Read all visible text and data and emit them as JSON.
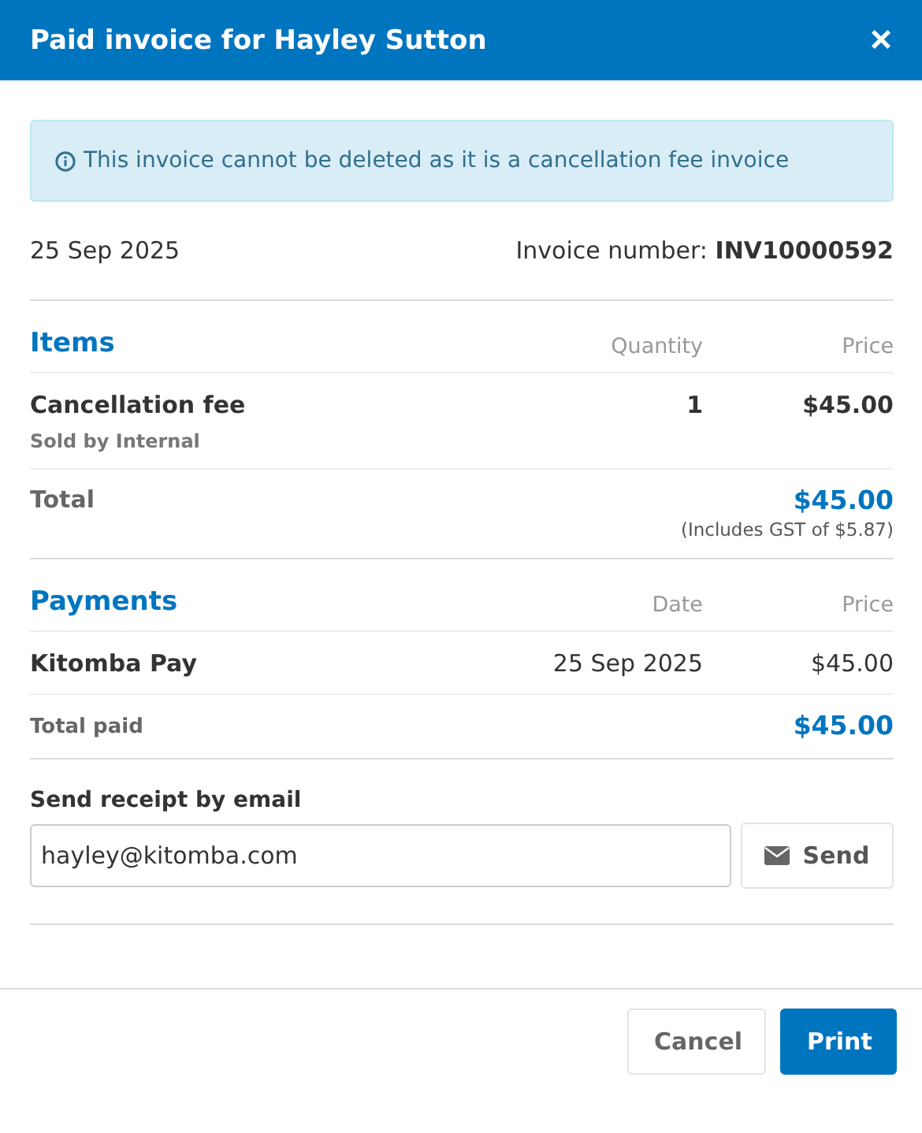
{
  "window": {
    "title": "Paid invoice for Hayley Sutton",
    "close": "×"
  },
  "notice": "This invoice cannot be deleted as it is a cancellation fee invoice",
  "date": "25 Sep 2025",
  "invoice_number": {
    "label": "Invoice number:",
    "value": "INV10000592"
  },
  "items": {
    "title": "Items",
    "columns": [
      "Quantity",
      "Price"
    ],
    "rows": [
      {
        "name": "Cancellation fee",
        "sold_by": "Sold by Internal",
        "quantity": "1",
        "price": "$45.00"
      }
    ],
    "total": {
      "label": "Total",
      "value": "$45.00",
      "note": "(Includes GST of $5.87)"
    }
  },
  "payments": {
    "title": "Payments",
    "columns": [
      "Date",
      "Price"
    ],
    "rows": [
      {
        "name": "Kitomba Pay",
        "date": "25 Sep 2025",
        "price": "$45.00"
      }
    ],
    "total": {
      "label": "Total paid",
      "value": "$45.00"
    }
  },
  "receipt": {
    "label": "Send receipt by email",
    "value": "hayley@kitomba.com",
    "button": "Send"
  },
  "buttons": [
    {
      "label": "Cancel",
      "kind": "secondary"
    },
    {
      "label": "Print",
      "kind": "primary"
    }
  ]
}
